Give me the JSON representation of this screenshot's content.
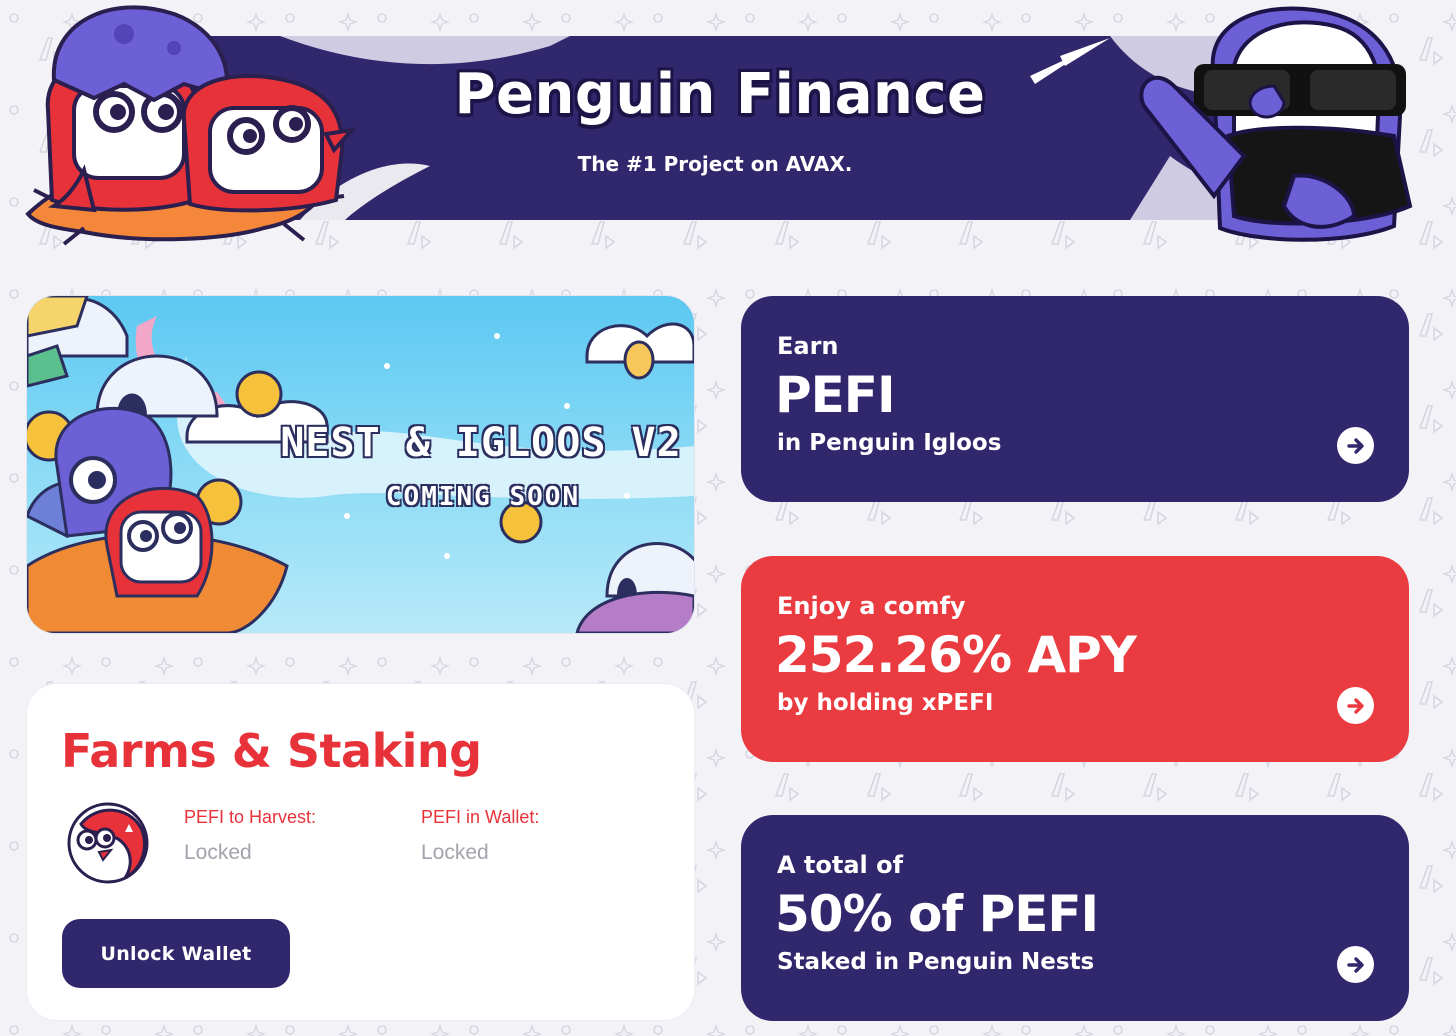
{
  "hero": {
    "title": "Penguin Finance",
    "subtitle": "The #1 Project on AVAX."
  },
  "nest_banner": {
    "title": "NEST & IGLOOS V2",
    "subtitle": "COMING SOON"
  },
  "farms": {
    "title": "Farms & Staking",
    "harvest_label": "PEFI to Harvest:",
    "harvest_value": "Locked",
    "wallet_label": "PEFI in Wallet:",
    "wallet_value": "Locked",
    "unlock_label": "Unlock Wallet"
  },
  "cards": [
    {
      "pre": "Earn",
      "big": "PEFI",
      "post": "in Penguin Igloos",
      "color": "#31276c",
      "icon": "arrow-right-icon"
    },
    {
      "pre": "Enjoy a comfy",
      "big": "252.26% APY",
      "post": "by holding xPEFI",
      "color": "#ea3b40",
      "icon": "arrow-right-icon"
    },
    {
      "pre": "A total of",
      "big": "50% of PEFI",
      "post": "Staked in Penguin Nests",
      "color": "#31276c",
      "icon": "arrow-right-icon"
    }
  ],
  "colors": {
    "primary_purple": "#31276c",
    "accent_red": "#ea3b40",
    "background": "#f3f3f7",
    "muted_text": "#a3a3ad"
  }
}
